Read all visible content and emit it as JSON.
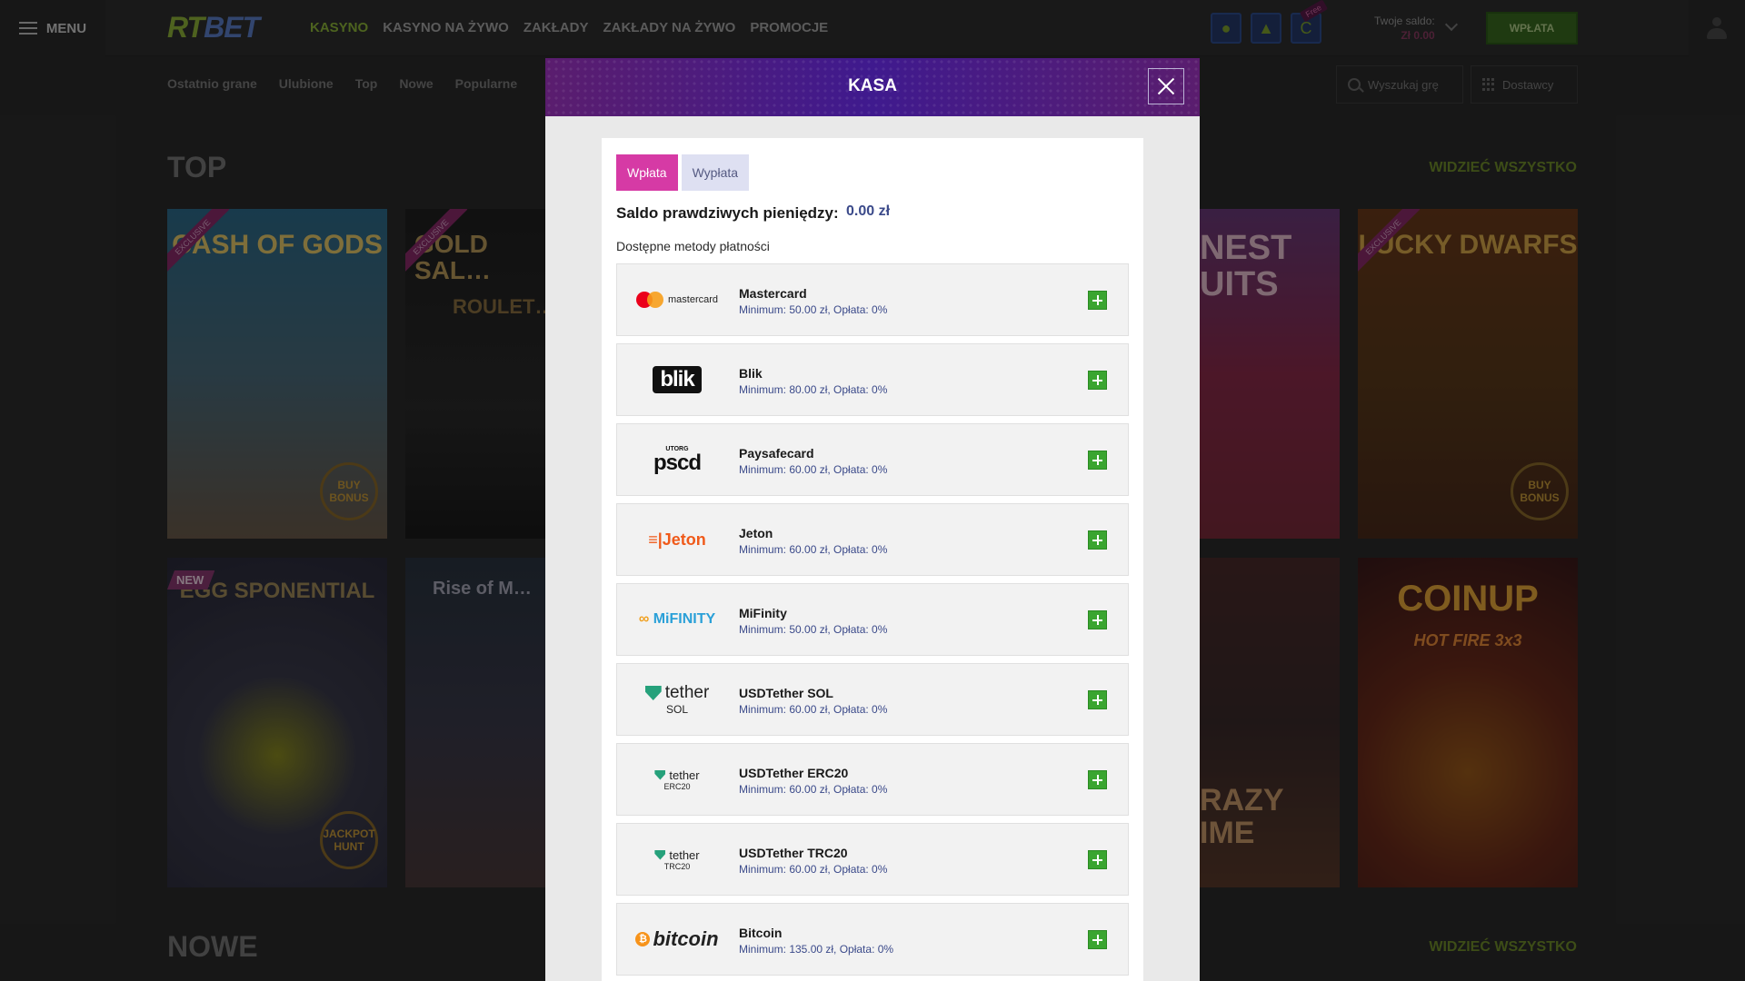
{
  "topbar": {
    "menu_label": "MENU",
    "logo_part1": "RT",
    "logo_part2": "BET",
    "nav": [
      "KASYNO",
      "KASYNO NA ŻYWO",
      "ZAKŁADY",
      "ZAKŁADY NA ŻYWO",
      "PROMOCJE"
    ],
    "free_tag": "Free",
    "balance_label": "Twoje saldo:",
    "balance_value": "Zł 0.00",
    "deposit_button": "WPŁATA"
  },
  "subnav": {
    "items": [
      "Ostatnio grane",
      "Ulubione",
      "Top",
      "Nowe",
      "Popularne"
    ],
    "search_placeholder": "Wyszukaj grę",
    "providers_label": "Dostawcy"
  },
  "sections": {
    "top_title": "TOP",
    "new_title": "NOWE",
    "see_all": "WIDZIEĆ WSZYSTKO"
  },
  "games": {
    "cash_of_gods": "CASH OF GODS",
    "gold_saloon": "GOLD SAL…",
    "roulette": "ROULET…",
    "finest_fruits": "NEST UITS",
    "lucky_dwarfs": "LUCKY DWARFS",
    "egg_sponential": "EGG SPONENTIAL",
    "rise_of": "Rise of M…",
    "crazy_time": "RAZY IME",
    "coin_up": "COINUP",
    "coin_up_sub": "HOT FIRE 3x3",
    "exclusive": "EXCLUSIVE",
    "new_tag": "NEW",
    "buy_bonus": "BUY BONUS",
    "jackpot_hunt": "JACKPOT HUNT"
  },
  "modal": {
    "title": "KASA",
    "tab_deposit": "Wpłata",
    "tab_withdraw": "Wypłata",
    "real_balance_label": "Saldo prawdziwych pieniędzy:",
    "real_balance_value": "0.00 zł",
    "methods_label": "Dostępne metody płatności",
    "methods": [
      {
        "name": "Mastercard",
        "info": "Minimum: 50.00 zł, Opłata: 0%",
        "logo_text": "mastercard"
      },
      {
        "name": "Blik",
        "info": "Minimum: 80.00 zł, Opłata: 0%",
        "logo_text": "blik"
      },
      {
        "name": "Paysafecard",
        "info": "Minimum: 60.00 zł, Opłata: 0%",
        "logo_text": "pscd",
        "logo_sub": "UTORG"
      },
      {
        "name": "Jeton",
        "info": "Minimum: 60.00 zł, Opłata: 0%",
        "logo_text": "Jeton"
      },
      {
        "name": "MiFinity",
        "info": "Minimum: 50.00 zł, Opłata: 0%",
        "logo_text": "MiFINITY"
      },
      {
        "name": "USDTether SOL",
        "info": "Minimum: 60.00 zł, Opłata: 0%",
        "logo_text": "tether",
        "logo_sub": "SOL"
      },
      {
        "name": "USDTether ERC20",
        "info": "Minimum: 60.00 zł, Opłata: 0%",
        "logo_text": "tether",
        "logo_sub": "ERC20"
      },
      {
        "name": "USDTether TRC20",
        "info": "Minimum: 60.00 zł, Opłata: 0%",
        "logo_text": "tether",
        "logo_sub": "TRC20"
      },
      {
        "name": "Bitcoin",
        "info": "Minimum: 135.00 zł, Opłata: 0%",
        "logo_text": "bitcoin"
      }
    ]
  }
}
